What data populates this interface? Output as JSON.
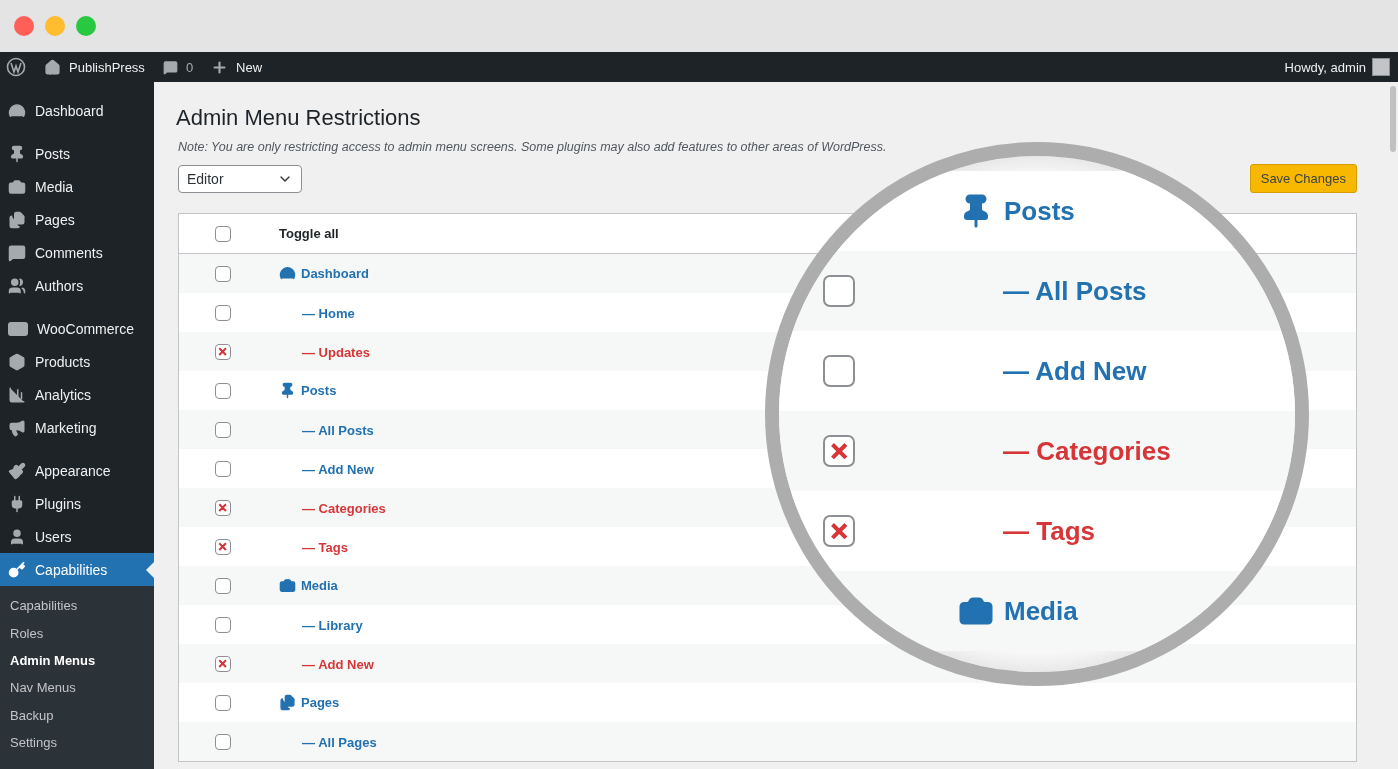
{
  "top_bar": {
    "site": "PublishPress",
    "comments": "0",
    "new": "New",
    "greeting": "Howdy, admin"
  },
  "sidebar": {
    "groups": [
      [
        {
          "label": "Dashboard",
          "selected": false
        }
      ],
      [
        {
          "label": "Posts",
          "selected": false
        },
        {
          "label": "Media",
          "selected": false
        },
        {
          "label": "Pages",
          "selected": false
        },
        {
          "label": "Comments",
          "selected": false
        },
        {
          "label": "Authors",
          "selected": false
        }
      ],
      [
        {
          "label": "WooCommerce",
          "selected": false
        },
        {
          "label": "Products",
          "selected": false
        },
        {
          "label": "Analytics",
          "selected": false
        },
        {
          "label": "Marketing",
          "selected": false
        }
      ],
      [
        {
          "label": "Appearance",
          "selected": false
        },
        {
          "label": "Plugins",
          "selected": false
        },
        {
          "label": "Users",
          "selected": false
        },
        {
          "label": "Capabilities",
          "selected": true
        }
      ]
    ],
    "submenu": [
      {
        "label": "Capabilities",
        "selected": false
      },
      {
        "label": "Roles",
        "selected": false
      },
      {
        "label": "Admin Menus",
        "selected": true
      },
      {
        "label": "Nav Menus",
        "selected": false
      },
      {
        "label": "Backup",
        "selected": false
      },
      {
        "label": "Settings",
        "selected": false
      }
    ]
  },
  "page": {
    "title": "Admin Menu Restrictions",
    "note": "Note: You are only restricting access to admin menu screens. Some plugins may also add features to other areas of WordPress.",
    "role_select": {
      "value": "Editor"
    },
    "save_button": "Save Changes"
  },
  "table": {
    "toggle_all": {
      "label": "Toggle all",
      "checked": false
    },
    "rows": [
      {
        "kind": "menu",
        "label": "Dashboard",
        "checked": false
      },
      {
        "kind": "sub",
        "label": "— Home",
        "checked": false
      },
      {
        "kind": "sub",
        "label": "— Updates",
        "checked": true
      },
      {
        "kind": "menu",
        "label": "Posts",
        "checked": false
      },
      {
        "kind": "sub",
        "label": "— All Posts",
        "checked": false
      },
      {
        "kind": "sub",
        "label": "— Add New",
        "checked": false
      },
      {
        "kind": "sub",
        "label": "— Categories",
        "checked": true
      },
      {
        "kind": "sub",
        "label": "— Tags",
        "checked": true
      },
      {
        "kind": "menu",
        "label": "Media",
        "checked": false
      },
      {
        "kind": "sub",
        "label": "— Library",
        "checked": false
      },
      {
        "kind": "sub",
        "label": "— Add New",
        "checked": true
      },
      {
        "kind": "menu",
        "label": "Pages",
        "checked": false
      },
      {
        "kind": "sub",
        "label": "— All Pages",
        "checked": false
      }
    ]
  },
  "magnifier": {
    "rows": [
      {
        "kind": "menu",
        "label": "Posts"
      },
      {
        "kind": "sub",
        "label": "— All Posts",
        "checked": false
      },
      {
        "kind": "sub",
        "label": "— Add New",
        "checked": false
      },
      {
        "kind": "sub",
        "label": "— Categories",
        "checked": true
      },
      {
        "kind": "sub",
        "label": "— Tags",
        "checked": true
      },
      {
        "kind": "menu",
        "label": "Media"
      }
    ]
  }
}
